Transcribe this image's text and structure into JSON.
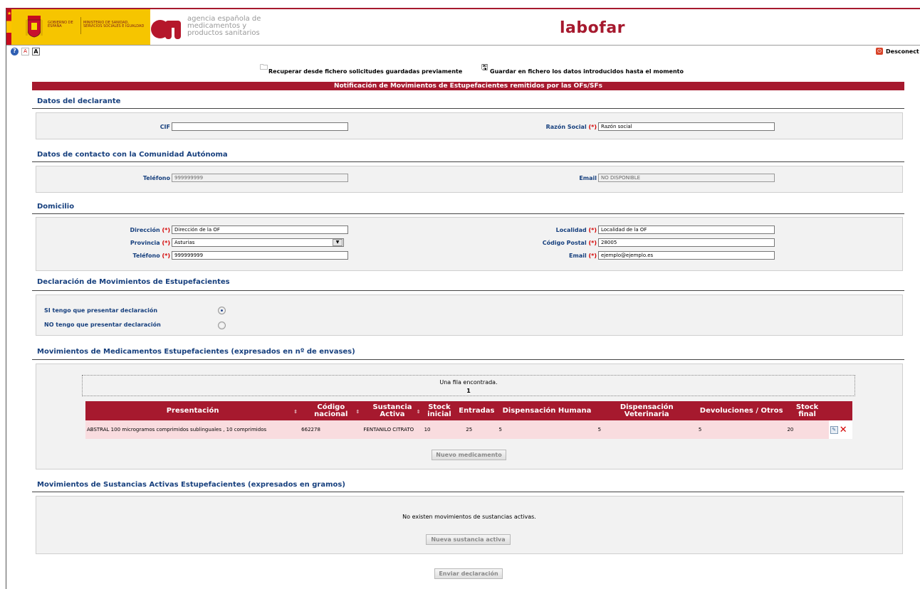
{
  "header": {
    "gov_star": "★",
    "gov_text_1": "Gobierno de España",
    "gov_text_2": "Ministerio de Sanidad, Servicios Sociales e Igualdad",
    "aemps_text": "agencia española de medicamentos y productos sanitarios",
    "labofar": "labofar"
  },
  "toolbar": {
    "help_icon": "?",
    "pdf_icon": "A",
    "font_icon": "A",
    "logout_icon": "⏻",
    "logout_label": "Desconect"
  },
  "file_actions": {
    "recover_label": "Recuperar desde fichero solicitudes guardadas previamente",
    "save_label": "Guardar en fichero los datos introducidos hasta el momento",
    "recover_icon": "🗀",
    "save_icon": "🖫"
  },
  "form_title": "Notificación de Movimientos de Estupefacientes remitidos por las OFs/SFs",
  "declarante": {
    "title": "Datos del declarante",
    "cif_label": "CIF",
    "cif_value": "",
    "razon_label": "Razón Social",
    "razon_value": "Razón social"
  },
  "contacto": {
    "title": "Datos de contacto con la Comunidad Autónoma",
    "telefono_label": "Teléfono",
    "telefono_value": "999999999",
    "email_label": "Email",
    "email_value": "NO DISPONIBLE"
  },
  "domicilio": {
    "title": "Domicilio",
    "direccion_label": "Dirección",
    "direccion_value": "Dirección de la OF",
    "provincia_label": "Provincia",
    "provincia_value": "Asturias",
    "telefono_label": "Teléfono",
    "telefono_value": "999999999",
    "localidad_label": "Localidad",
    "localidad_value": "Localidad de la OF",
    "cp_label": "Código Postal",
    "cp_value": "28005",
    "email_label": "Email",
    "email_value": "ejemplo@ejemplo.es"
  },
  "required_marker": "(*)",
  "declaracion": {
    "title": "Declaración de Movimientos de Estupefacientes",
    "si_label": "SI tengo que presentar declaración",
    "no_label": "NO tengo que presentar declaración",
    "selected": "si"
  },
  "medicamentos": {
    "title": "Movimientos de Medicamentos Estupefacientes (expresados en nº de envases)",
    "pager_text": "Una fila encontrada.",
    "pager_page": "1",
    "sort_glyph": "⇕",
    "columns": [
      "Presentación",
      "Código nacional",
      "Sustancia Activa",
      "Stock inicial",
      "Entradas",
      "Dispensación Humana",
      "Dispensación Veterinaria",
      "Devoluciones / Otros",
      "Stock final"
    ],
    "rows": [
      {
        "presentacion": "ABSTRAL 100 microgramos comprimidos sublinguales , 10 comprimidos",
        "codigo": "662278",
        "sustancia": "FENTANILO CITRATO",
        "stock_inicial": "10",
        "entradas": "25",
        "disp_humana": "5",
        "disp_veterinaria": "5",
        "devoluciones": "5",
        "stock_final": "20"
      }
    ],
    "edit_icon": "✎",
    "delete_icon": "✕",
    "new_button": "Nuevo medicamento"
  },
  "sustancias": {
    "title": "Movimientos de Sustancias Activas Estupefacientes (expresados en gramos)",
    "empty_text": "No existen movimientos de sustancias activas.",
    "new_button": "Nueva sustancia activa"
  },
  "submit_button": "Enviar declaración",
  "colors": {
    "brand_red": "#a6192e",
    "heading_blue": "#17407e",
    "gov_yellow": "#f6c500",
    "row_pink": "#f9dcdf"
  }
}
